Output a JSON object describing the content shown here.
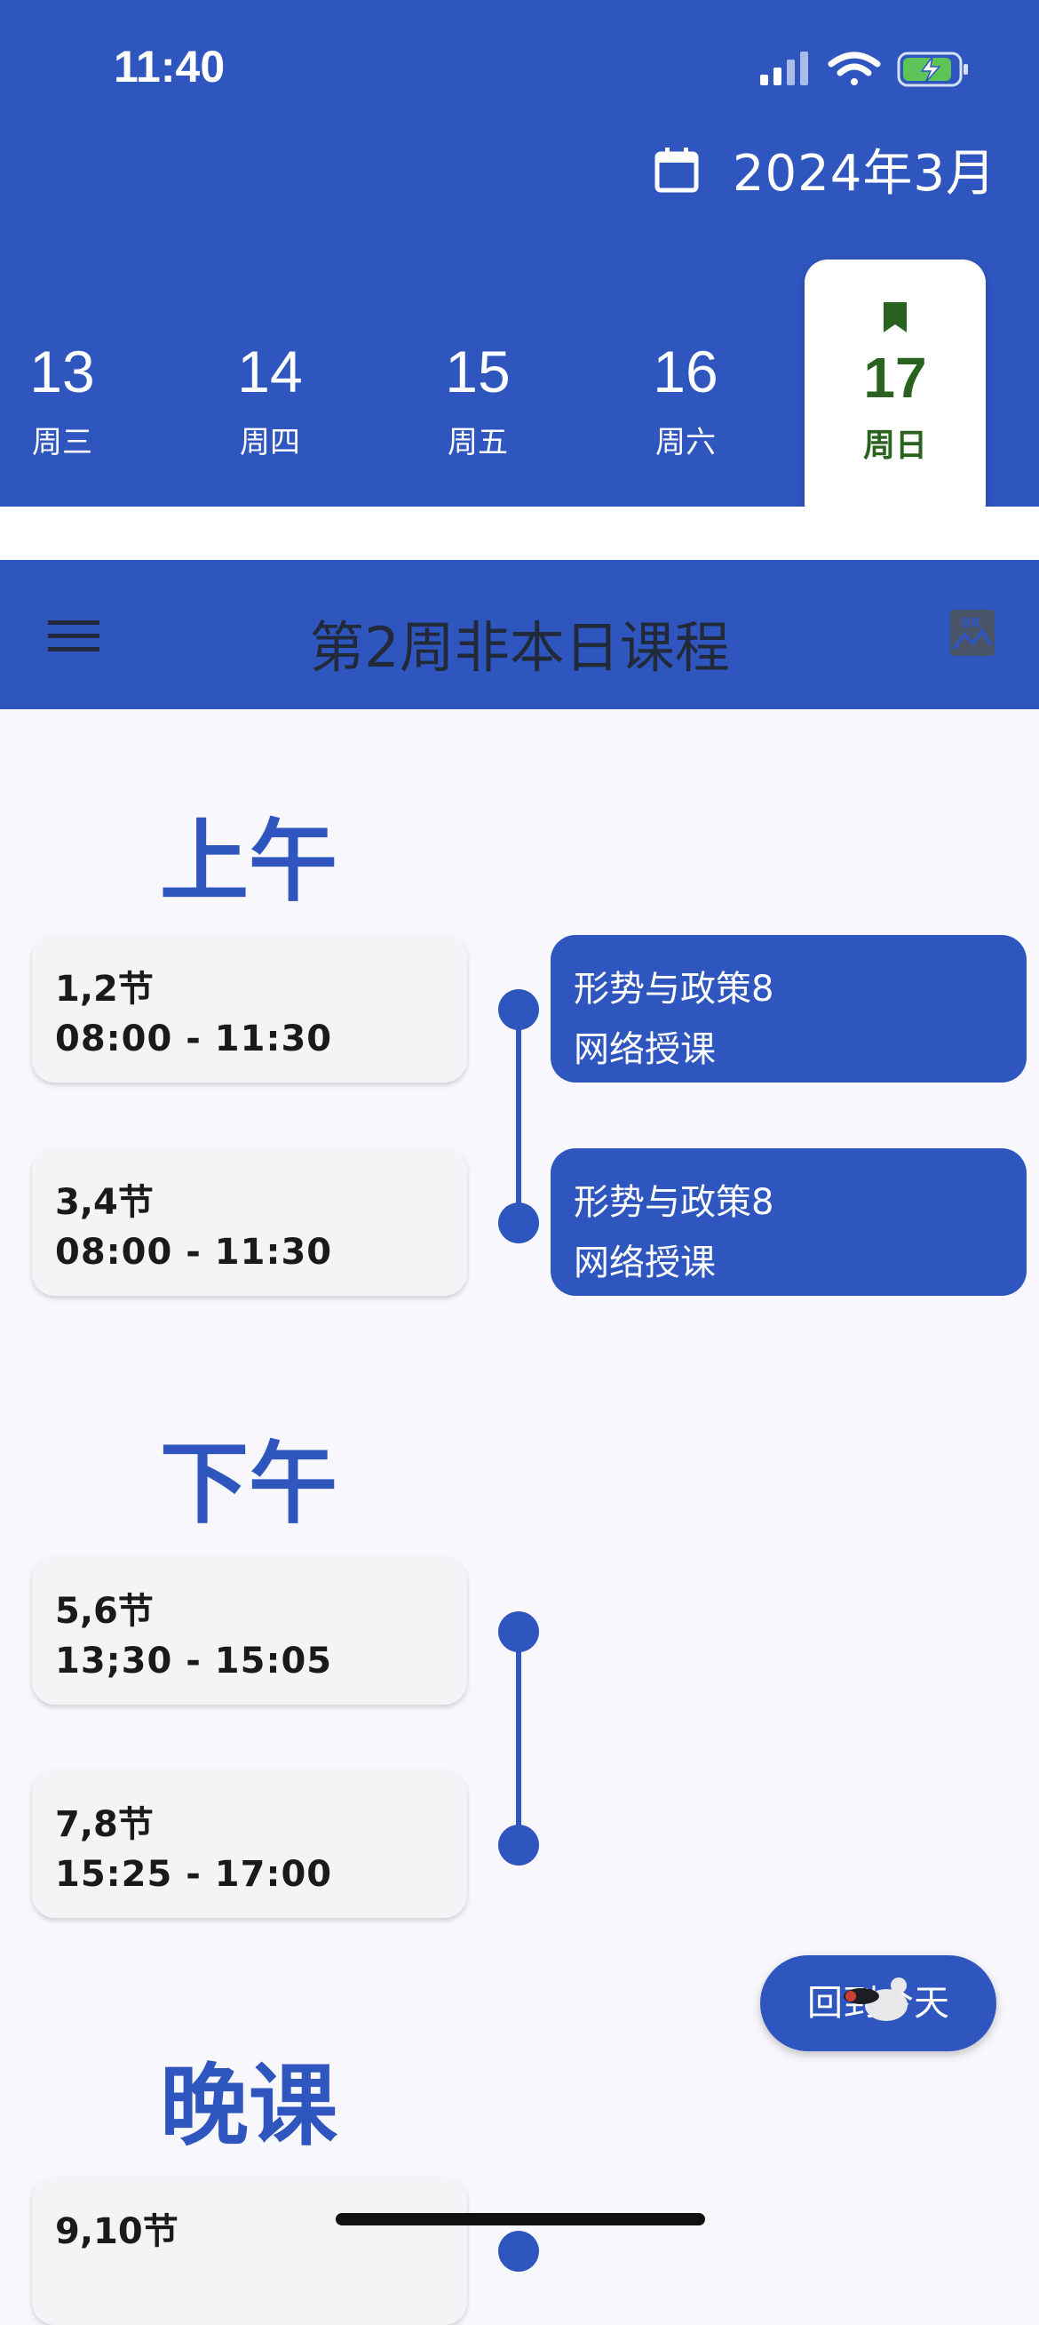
{
  "status_bar": {
    "time": "11:40"
  },
  "header": {
    "month": "2024年3月",
    "days": [
      {
        "num": "13",
        "weekday": "周三"
      },
      {
        "num": "14",
        "weekday": "周四"
      },
      {
        "num": "15",
        "weekday": "周五"
      },
      {
        "num": "16",
        "weekday": "周六"
      }
    ],
    "selected_day": {
      "num": "17",
      "weekday": "周日"
    }
  },
  "appbar": {
    "title": "第2周非本日课程"
  },
  "sections": {
    "morning": {
      "title": "上午",
      "slots": [
        {
          "period": "1,2节",
          "time": "08:00 - 11:30"
        },
        {
          "period": "3,4节",
          "time": "08:00 - 11:30"
        }
      ],
      "courses": [
        {
          "name": "形势与政策8",
          "mode": "网络授课"
        },
        {
          "name": "形势与政策8",
          "mode": "网络授课"
        }
      ]
    },
    "afternoon": {
      "title": "下午",
      "slots": [
        {
          "period": "5,6节",
          "time": "13;30 - 15:05"
        },
        {
          "period": "7,8节",
          "time": "15:25 - 17:00"
        }
      ]
    },
    "evening": {
      "title": "晚课",
      "slots": [
        {
          "period": "9,10节",
          "time": ""
        }
      ]
    }
  },
  "fab": {
    "label": "回到今天"
  },
  "colors": {
    "primary": "#2f56bf",
    "selected_text": "#2a6320",
    "background": "#f8f7fb"
  }
}
